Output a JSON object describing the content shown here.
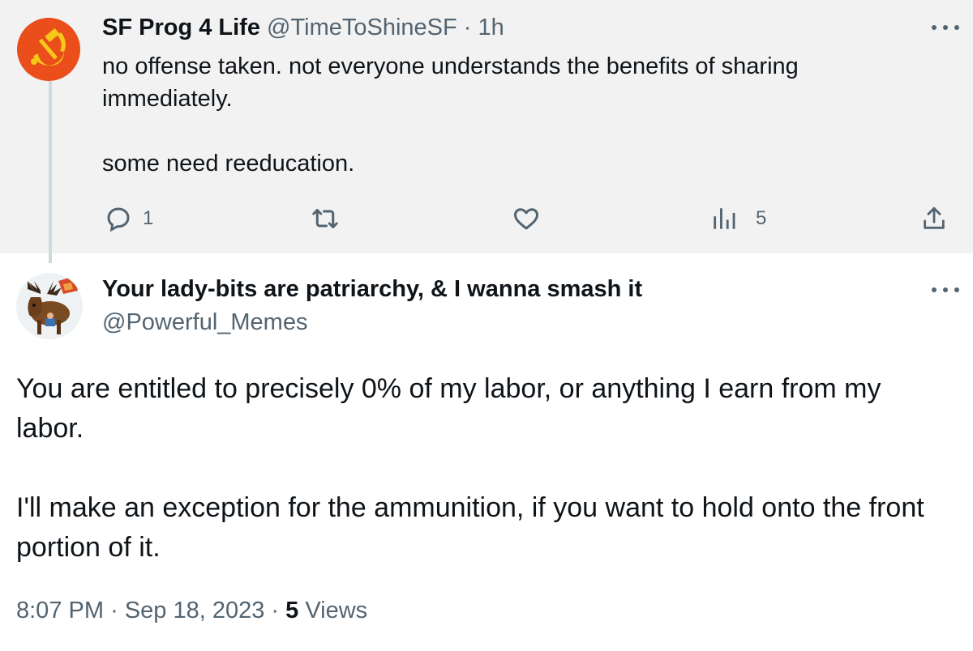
{
  "reply_tweet": {
    "display_name": "SF Prog 4 Life",
    "handle": "@TimeToShineSF",
    "separator": "·",
    "time_ago": "1h",
    "text_line_1": "no offense taken. not everyone understands the benefits of sharing immediately.",
    "text_line_2": "some need reeducation.",
    "reply_count": "1",
    "view_count": "5",
    "avatar_icon": "hammer-and-sickle-icon",
    "background_color": "#f2f2f2"
  },
  "main_tweet": {
    "display_name": "Your lady-bits are patriarchy, & I wanna smash it",
    "handle": "@Powerful_Memes",
    "paragraph_1": "You are entitled to precisely 0% of my labor, or anything I earn from my labor.",
    "paragraph_2": "I'll make an exception for the ammunition, if you want to hold onto the front portion of it.",
    "time": "8:07 PM",
    "separator_1": "·",
    "date": "Sep 18, 2023",
    "separator_2": "·",
    "views_count": "5",
    "views_label": "Views",
    "avatar_icon": "moose-avatar-icon"
  },
  "colors": {
    "text_primary": "#0f1419",
    "text_secondary": "#536471",
    "thread_line": "#cfd9de"
  }
}
